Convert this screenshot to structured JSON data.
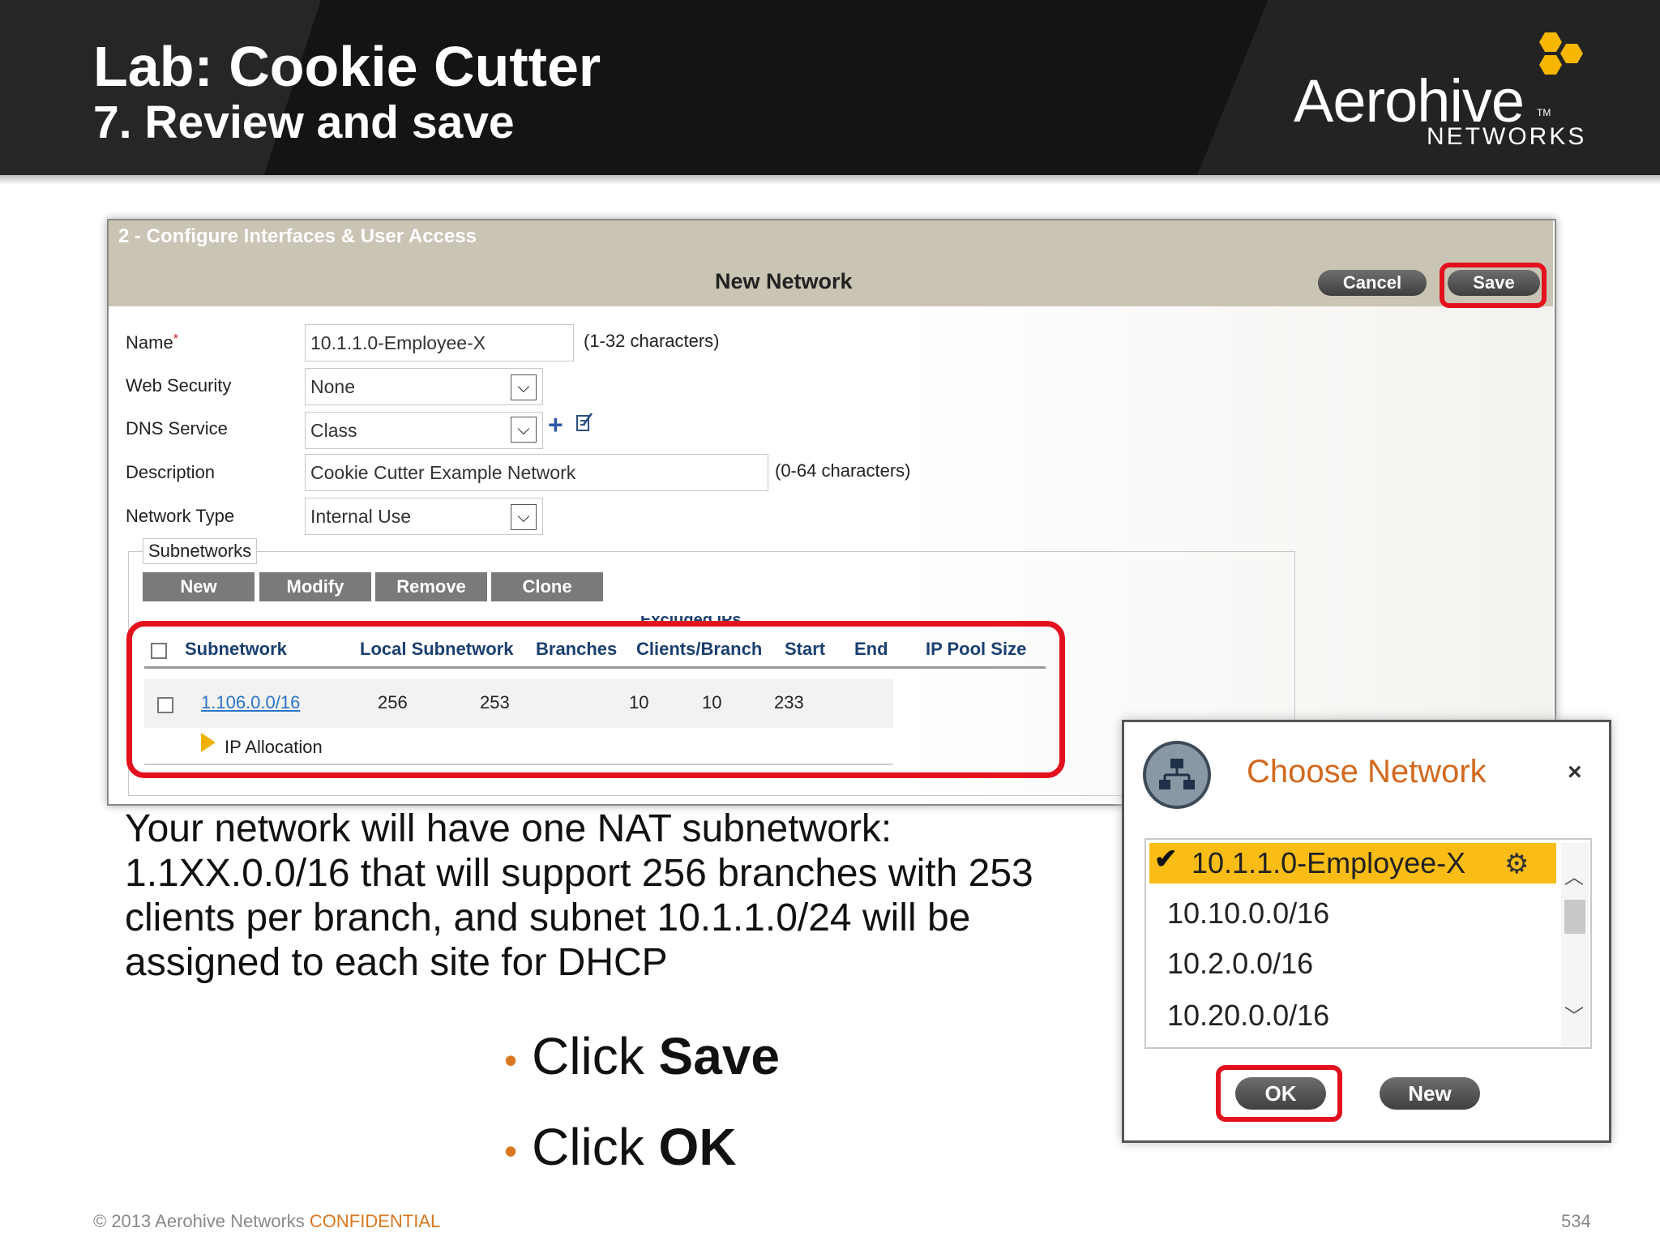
{
  "slide": {
    "title": "Lab: Cookie Cutter",
    "subtitle": "7. Review and save",
    "logo_word": "Aerohive",
    "logo_tm": "TM",
    "logo_sub": "NETWORKS"
  },
  "panel": {
    "step_title": "2 - Configure Interfaces & User Access",
    "title": "New Network",
    "cancel_label": "Cancel",
    "save_label": "Save"
  },
  "form": {
    "name_label": "Name",
    "required_mark": "*",
    "name_value": "10.1.1.0-Employee-X",
    "name_hint": "(1-32 characters)",
    "web_security_label": "Web Security",
    "web_security_value": "None",
    "dns_service_label": "DNS Service",
    "dns_service_value": "Class",
    "description_label": "Description",
    "description_value": "Cookie Cutter Example Network",
    "description_hint": "(0-64 characters)",
    "network_type_label": "Network Type",
    "network_type_value": "Internal Use"
  },
  "subnetworks": {
    "legend": "Subnetworks",
    "buttons": [
      "New",
      "Modify",
      "Remove",
      "Clone"
    ],
    "excluded_group": "Excluded IPs",
    "columns": [
      "Subnetwork",
      "Local Subnetwork",
      "Branches",
      "Clients/Branch",
      "Start",
      "End",
      "IP Pool Size"
    ],
    "rows": [
      {
        "subnetwork": "1.106.0.0/16",
        "local_subnetwork": "256",
        "branches": "253",
        "clients_per_branch": "10",
        "start": "10",
        "end": "233",
        "ip_pool_size": ""
      }
    ],
    "ip_allocation": "IP Allocation"
  },
  "body": {
    "paragraph": "Your network will have one NAT subnetwork: 1.1XX.0.0/16 that will support 256 branches with 253 clients per branch, and subnet 10.1.1.0/24 will be assigned to each site for DHCP",
    "bullet1_prefix": "Click ",
    "bullet1_bold": "Save",
    "bullet2_prefix": "Click ",
    "bullet2_bold": "OK"
  },
  "choose_network": {
    "title": "Choose Network",
    "close": "×",
    "items": [
      "10.1.1.0-Employee-X",
      "10.10.0.0/16",
      "10.2.0.0/16",
      "10.20.0.0/16"
    ],
    "selected_index": 0,
    "ok_label": "OK",
    "new_label": "New"
  },
  "footer": {
    "copyright": "© 2013 Aerohive Networks ",
    "confidential": "CONFIDENTIAL",
    "page_number": "534"
  },
  "colors": {
    "highlight": "#e3101d",
    "accent_orange": "#d9771f",
    "selected_yellow": "#f9bd16",
    "link_blue": "#2a74c8"
  }
}
